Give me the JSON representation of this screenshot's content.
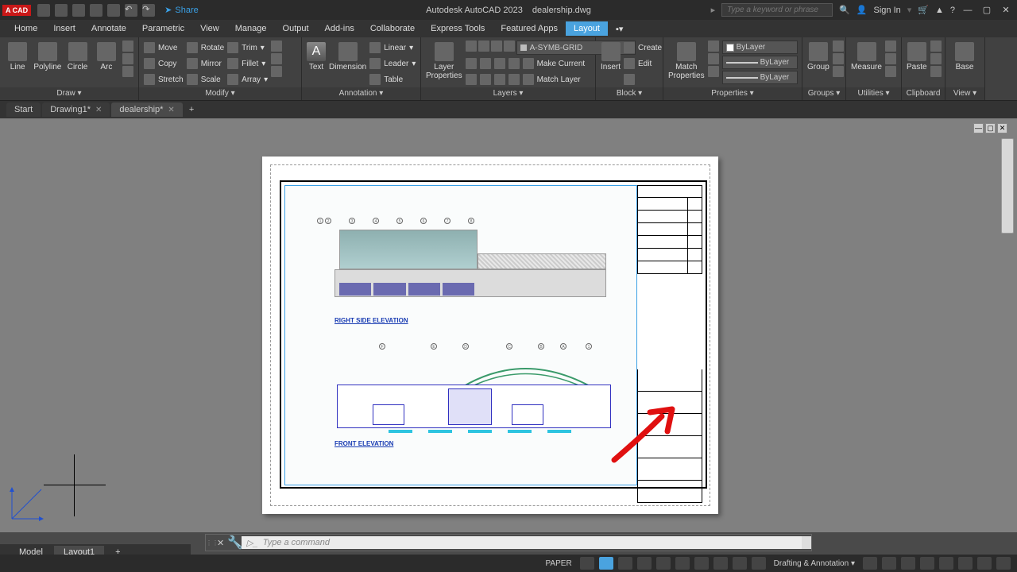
{
  "title": {
    "app": "Autodesk AutoCAD 2023",
    "file": "dealership.dwg",
    "badge": "A CAD"
  },
  "qat": {
    "share": "Share"
  },
  "search": {
    "placeholder": "Type a keyword or phrase"
  },
  "signin": "Sign In",
  "menu": [
    "Home",
    "Insert",
    "Annotate",
    "Parametric",
    "View",
    "Manage",
    "Output",
    "Add-ins",
    "Collaborate",
    "Express Tools",
    "Featured Apps",
    "Layout"
  ],
  "menu_active": 11,
  "ribbon": {
    "draw": {
      "title": "Draw",
      "btns": [
        "Line",
        "Polyline",
        "Circle",
        "Arc"
      ]
    },
    "modify": {
      "title": "Modify",
      "rows": [
        [
          "Move",
          "Rotate",
          "Trim"
        ],
        [
          "Copy",
          "Mirror",
          "Fillet"
        ],
        [
          "Stretch",
          "Scale",
          "Array"
        ]
      ]
    },
    "annotation": {
      "title": "Annotation",
      "big": [
        "Text",
        "Dimension"
      ],
      "rows": [
        "Linear",
        "Leader",
        "Table"
      ]
    },
    "layers": {
      "title": "Layers",
      "big": "Layer\nProperties",
      "current": "A-SYMB-GRID",
      "rows": [
        "Make Current",
        "Match Layer"
      ]
    },
    "block": {
      "title": "Block",
      "big": "Insert",
      "rows": [
        "Create",
        "Edit",
        ""
      ]
    },
    "properties": {
      "title": "Properties",
      "big": "Match\nProperties",
      "color": "ByLayer",
      "lw": "ByLayer",
      "lt": "ByLayer"
    },
    "groups": {
      "title": "Groups",
      "big": "Group"
    },
    "utilities": {
      "title": "Utilities",
      "big": "Measure"
    },
    "clipboard": {
      "title": "Clipboard",
      "big": "Paste"
    },
    "view": {
      "title": "View",
      "big": "Base"
    }
  },
  "file_tabs": [
    "Start",
    "Drawing1*",
    "dealership*"
  ],
  "file_tab_active": 2,
  "drawing": {
    "elev1": "RIGHT SIDE ELEVATION",
    "elev2": "FRONT ELEVATION"
  },
  "cmd": {
    "placeholder": "Type a command"
  },
  "bottom_tabs": [
    "Model",
    "Layout1"
  ],
  "bottom_tab_active": 1,
  "status": {
    "space": "PAPER",
    "workspace": "Drafting & Annotation"
  }
}
